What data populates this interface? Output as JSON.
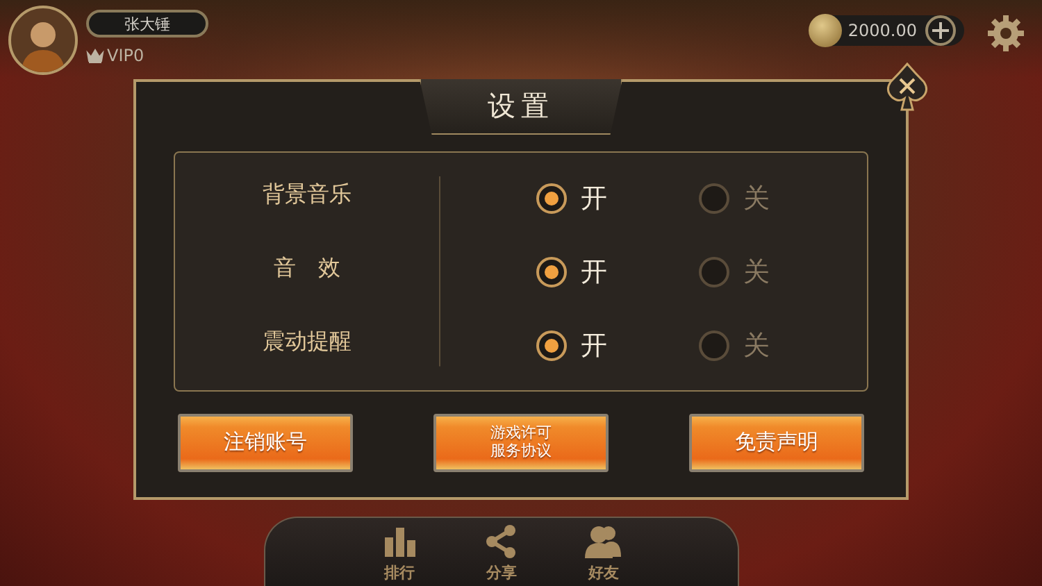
{
  "player": {
    "name": "张大锤",
    "vip": "VIP0"
  },
  "coins": {
    "amount": "2000.00"
  },
  "dialog": {
    "title": "设置",
    "settings": [
      {
        "label": "背景音乐",
        "options": [
          {
            "label": "开",
            "selected": true
          },
          {
            "label": "关",
            "selected": false
          }
        ]
      },
      {
        "label": "音　效",
        "options": [
          {
            "label": "开",
            "selected": true
          },
          {
            "label": "关",
            "selected": false
          }
        ]
      },
      {
        "label": "震动提醒",
        "options": [
          {
            "label": "开",
            "selected": true
          },
          {
            "label": "关",
            "selected": false
          }
        ]
      }
    ],
    "buttons": [
      {
        "lines": [
          "注销账号"
        ]
      },
      {
        "lines": [
          "游戏许可",
          "服务协议"
        ]
      },
      {
        "lines": [
          "免责声明"
        ]
      }
    ]
  },
  "nav": [
    {
      "label": "排行",
      "kind": "rank"
    },
    {
      "label": "分享",
      "kind": "share"
    },
    {
      "label": "好友",
      "kind": "friends"
    }
  ]
}
